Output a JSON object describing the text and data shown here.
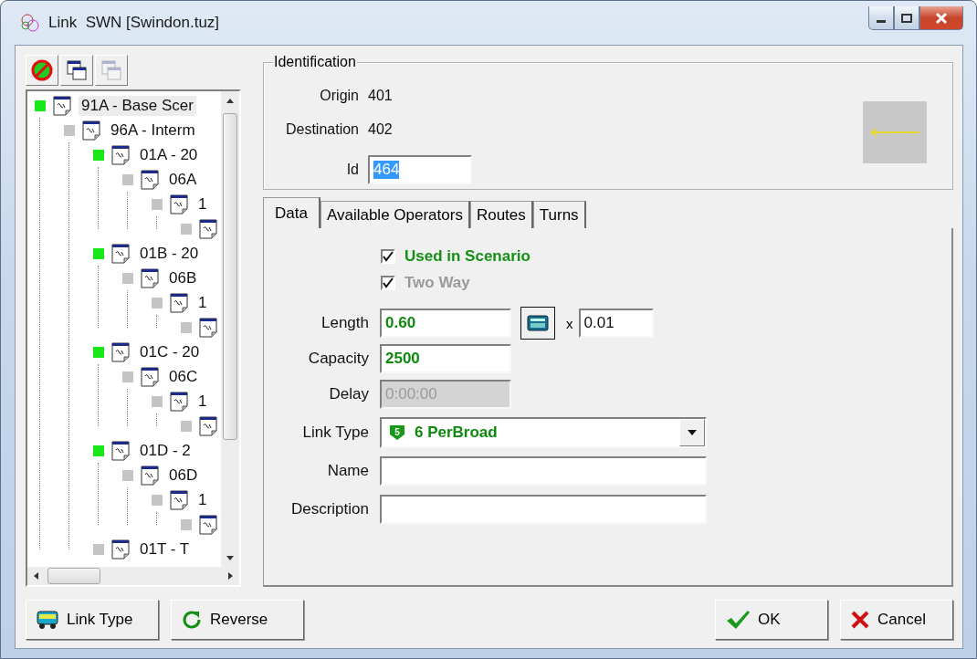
{
  "window": {
    "title": "Link  SWN [Swindon.tuz]"
  },
  "tree_toolbar": [
    {
      "kind": "no-entry",
      "disabled": false
    },
    {
      "kind": "windows",
      "disabled": false
    },
    {
      "kind": "windows",
      "disabled": true
    }
  ],
  "tree": [
    {
      "label": "91A  - Base Scer",
      "active": true,
      "selected": true,
      "children": [
        {
          "label": "96A  - Interm",
          "active": false,
          "selected": false,
          "children": [
            {
              "label": "01A  - 20",
              "active": true,
              "selected": false,
              "children": [
                {
                  "label": "06A",
                  "active": false,
                  "selected": false,
                  "children": [
                    {
                      "label": "1",
                      "active": false,
                      "selected": false,
                      "children": [
                        {
                          "active": false,
                          "selected": false
                        }
                      ]
                    }
                  ]
                }
              ]
            },
            {
              "label": "01B  - 20",
              "active": true,
              "selected": false,
              "children": [
                {
                  "label": "06B",
                  "active": false,
                  "selected": false,
                  "children": [
                    {
                      "label": "1",
                      "active": false,
                      "selected": false,
                      "children": [
                        {
                          "active": false,
                          "selected": false
                        }
                      ]
                    }
                  ]
                }
              ]
            },
            {
              "label": "01C  - 20",
              "active": true,
              "selected": false,
              "children": [
                {
                  "label": "06C",
                  "active": false,
                  "selected": false,
                  "children": [
                    {
                      "label": "1",
                      "active": false,
                      "selected": false,
                      "children": [
                        {
                          "active": false,
                          "selected": false
                        }
                      ]
                    }
                  ]
                }
              ]
            },
            {
              "label": "01D  - 2",
              "active": true,
              "selected": false,
              "children": [
                {
                  "label": "06D",
                  "active": false,
                  "selected": false,
                  "children": [
                    {
                      "label": "1",
                      "active": false,
                      "selected": false,
                      "children": [
                        {
                          "active": false,
                          "selected": false
                        }
                      ]
                    }
                  ]
                }
              ]
            },
            {
              "label": "01T  - T",
              "active": false,
              "selected": false
            }
          ]
        }
      ]
    }
  ],
  "identification": {
    "title": "Identification",
    "origin_label": "Origin",
    "origin": "401",
    "destination_label": "Destination",
    "destination": "402",
    "id_label": "Id",
    "id": "464",
    "id_selected": true
  },
  "tabs": [
    {
      "label": "Data",
      "selected": true
    },
    {
      "label": "Available Operators",
      "selected": false
    },
    {
      "label": "Routes",
      "selected": false
    },
    {
      "label": "Turns",
      "selected": false
    }
  ],
  "checkboxes": [
    {
      "label": "Used in Scenario",
      "checked": true,
      "disabled": false
    },
    {
      "label": "Two Way",
      "checked": true,
      "disabled": true
    }
  ],
  "fields": [
    {
      "label": "Length",
      "value": "0.60",
      "kind": "calc",
      "multiplier_sign": "x",
      "multiplier": "0.01",
      "disabled": false
    },
    {
      "label": "Capacity",
      "value": "2500",
      "kind": "short",
      "disabled": false
    },
    {
      "label": "Delay",
      "value": "0:00:00",
      "kind": "short",
      "disabled": true
    },
    {
      "label": "Link Type",
      "value": "6 PerBroad",
      "kind": "dropdown",
      "badge": "5",
      "disabled": false
    },
    {
      "label": "Name",
      "kind": "wide",
      "disabled": false
    },
    {
      "label": "Description",
      "kind": "wide",
      "disabled": false
    }
  ],
  "buttons": [
    {
      "label": "Link Type",
      "kind": "bus"
    },
    {
      "label": "Reverse",
      "kind": "refresh"
    },
    {
      "label": "OK",
      "kind": "check"
    },
    {
      "label": "Cancel",
      "kind": "cross"
    }
  ]
}
